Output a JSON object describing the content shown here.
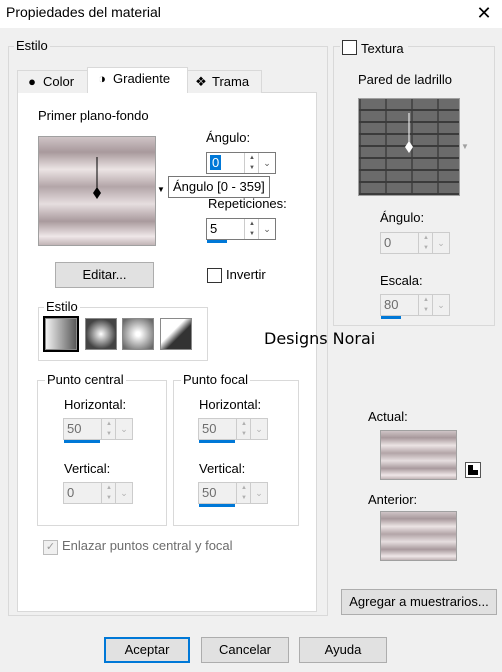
{
  "window": {
    "title": "Propiedades del material",
    "close_label": "✕"
  },
  "left_group": {
    "label": "Estilo"
  },
  "tabs": [
    {
      "label": "Color",
      "icon": "circle-icon"
    },
    {
      "label": "Gradiente",
      "icon": "gradient-icon"
    },
    {
      "label": "Trama",
      "icon": "pattern-icon"
    }
  ],
  "gradient": {
    "preview_label": "Primer plano-fondo",
    "angle_label": "Ángulo:",
    "angle_value": "0",
    "tooltip": "Ángulo [0 - 359]",
    "repeats_label": "Repeticiones:",
    "repeats_value": "5",
    "edit_button": "Editar...",
    "invert_label": "Invertir",
    "style_label": "Estilo",
    "center_point": {
      "label": "Punto central",
      "horizontal_label": "Horizontal:",
      "horizontal_value": "50",
      "vertical_label": "Vertical:",
      "vertical_value": "0"
    },
    "focal_point": {
      "label": "Punto focal",
      "horizontal_label": "Horizontal:",
      "horizontal_value": "50",
      "vertical_label": "Vertical:",
      "vertical_value": "50"
    },
    "link_label": "Enlazar puntos central y focal"
  },
  "texture": {
    "label": "Textura",
    "name": "Pared de ladrillo",
    "angle_label": "Ángulo:",
    "angle_value": "0",
    "scale_label": "Escala:",
    "scale_value": "80"
  },
  "watermark": "Designs Norai",
  "current_label": "Actual:",
  "previous_label": "Anterior:",
  "add_swatch_button": "Agregar a muestrarios...",
  "buttons": {
    "accept": "Aceptar",
    "cancel": "Cancelar",
    "help": "Ayuda"
  }
}
